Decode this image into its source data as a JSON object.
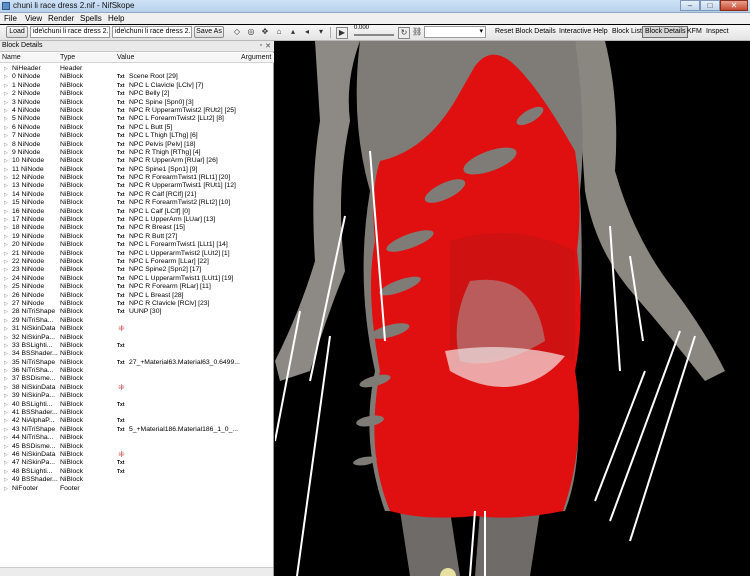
{
  "window": {
    "title": "chuni li race dress 2.nif - NifSkope",
    "minimize": "–",
    "maximize": "□",
    "close": "✕"
  },
  "menu": [
    "File",
    "View",
    "Render",
    "Spells",
    "Help"
  ],
  "toolbar": {
    "load": "Load",
    "load_path": "ide\\chuni li race dress 2.nif",
    "save_path": "ide\\chuni li race dress 2.nif",
    "save_as": "Save As",
    "lod_value": "0.000",
    "reset_block_details": "Reset Block Details",
    "interactive_help": "Interactive Help",
    "block_list": "Block List",
    "block_details": "Block Details",
    "kfm": "KFM",
    "inspect": "Inspect"
  },
  "panel": {
    "title": "Block Details",
    "float_icon": "▫",
    "close_icon": "✕",
    "columns": [
      "Name",
      "Type",
      "Value",
      "Argument"
    ],
    "rows": [
      {
        "name": "NiHeader",
        "type": "Header",
        "txt": false,
        "value": ""
      },
      {
        "name": "0 NiNode",
        "type": "NiBlock",
        "txt": true,
        "value": "Scene Root [29]"
      },
      {
        "name": "1 NiNode",
        "type": "NiBlock",
        "txt": true,
        "value": "NPC L Clavicle [LClv] [7]"
      },
      {
        "name": "2 NiNode",
        "type": "NiBlock",
        "txt": true,
        "value": "NPC Belly [2]"
      },
      {
        "name": "3 NiNode",
        "type": "NiBlock",
        "txt": true,
        "value": "NPC Spine [Spn0] [3]"
      },
      {
        "name": "4 NiNode",
        "type": "NiBlock",
        "txt": true,
        "value": "NPC R UpperarmTwist2 [RUt2] [25]"
      },
      {
        "name": "5 NiNode",
        "type": "NiBlock",
        "txt": true,
        "value": "NPC L ForearmTwist2 [LLt2] [8]"
      },
      {
        "name": "6 NiNode",
        "type": "NiBlock",
        "txt": true,
        "value": "NPC L Butt [5]"
      },
      {
        "name": "7 NiNode",
        "type": "NiBlock",
        "txt": true,
        "value": "NPC L Thigh [LThg] [6]"
      },
      {
        "name": "8 NiNode",
        "type": "NiBlock",
        "txt": true,
        "value": "NPC Pelvis [Pelv] [18]"
      },
      {
        "name": "9 NiNode",
        "type": "NiBlock",
        "txt": true,
        "value": "NPC R Thigh [RThg] [4]"
      },
      {
        "name": "10 NiNode",
        "type": "NiBlock",
        "txt": true,
        "value": "NPC R UpperArm [RUar] [26]"
      },
      {
        "name": "11 NiNode",
        "type": "NiBlock",
        "txt": true,
        "value": "NPC Spine1 [Spn1] [9]"
      },
      {
        "name": "12 NiNode",
        "type": "NiBlock",
        "txt": true,
        "value": "NPC R ForearmTwist1 [RLt1] [20]"
      },
      {
        "name": "13 NiNode",
        "type": "NiBlock",
        "txt": true,
        "value": "NPC R UpperarmTwist1 [RUt1] [12]"
      },
      {
        "name": "14 NiNode",
        "type": "NiBlock",
        "txt": true,
        "value": "NPC R Calf [RClf] [21]"
      },
      {
        "name": "15 NiNode",
        "type": "NiBlock",
        "txt": true,
        "value": "NPC R ForearmTwist2 [RLt2] [10]"
      },
      {
        "name": "16 NiNode",
        "type": "NiBlock",
        "txt": true,
        "value": "NPC L Calf [LClf] [0]"
      },
      {
        "name": "17 NiNode",
        "type": "NiBlock",
        "txt": true,
        "value": "NPC L UpperArm [LUar] [13]"
      },
      {
        "name": "18 NiNode",
        "type": "NiBlock",
        "txt": true,
        "value": "NPC R Breast [15]"
      },
      {
        "name": "19 NiNode",
        "type": "NiBlock",
        "txt": true,
        "value": "NPC R Butt [27]"
      },
      {
        "name": "20 NiNode",
        "type": "NiBlock",
        "txt": true,
        "value": "NPC L ForearmTwist1 [LLt1] [14]"
      },
      {
        "name": "21 NiNode",
        "type": "NiBlock",
        "txt": true,
        "value": "NPC L UpperarmTwist2 [LUt2] [1]"
      },
      {
        "name": "22 NiNode",
        "type": "NiBlock",
        "txt": true,
        "value": "NPC L Forearm [LLar] [22]"
      },
      {
        "name": "23 NiNode",
        "type": "NiBlock",
        "txt": true,
        "value": "NPC Spine2 [Spn2] [17]"
      },
      {
        "name": "24 NiNode",
        "type": "NiBlock",
        "txt": true,
        "value": "NPC L UpperarmTwist1 [LUt1] [19]"
      },
      {
        "name": "25 NiNode",
        "type": "NiBlock",
        "txt": true,
        "value": "NPC R Forearm [RLar] [11]"
      },
      {
        "name": "26 NiNode",
        "type": "NiBlock",
        "txt": true,
        "value": "NPC L Breast [28]"
      },
      {
        "name": "27 NiNode",
        "type": "NiBlock",
        "txt": true,
        "value": "NPC R Clavicle [RClv] [23]"
      },
      {
        "name": "28 NiTriShape",
        "type": "NiBlock",
        "txt": true,
        "value": "UUNP [30]"
      },
      {
        "name": "29 NiTriSha...",
        "type": "NiBlock",
        "txt": false,
        "value": ""
      },
      {
        "name": "31 NiSkinData",
        "type": "NiBlock",
        "txt": false,
        "skin": true,
        "value": ""
      },
      {
        "name": "32 NiSkinPa...",
        "type": "NiBlock",
        "txt": false,
        "value": ""
      },
      {
        "name": "33 BSLighti...",
        "type": "NiBlock",
        "txt": true,
        "value": ""
      },
      {
        "name": "34 BSShader...",
        "type": "NiBlock",
        "txt": false,
        "value": ""
      },
      {
        "name": "35 NiTriShape",
        "type": "NiBlock",
        "txt": true,
        "value": "27_+Material63.Material63_0.6499..."
      },
      {
        "name": "36 NiTriSha...",
        "type": "NiBlock",
        "txt": false,
        "value": ""
      },
      {
        "name": "37 BSDisme...",
        "type": "NiBlock",
        "txt": false,
        "value": ""
      },
      {
        "name": "38 NiSkinData",
        "type": "NiBlock",
        "txt": false,
        "skin": true,
        "value": ""
      },
      {
        "name": "39 NiSkinPa...",
        "type": "NiBlock",
        "txt": false,
        "value": ""
      },
      {
        "name": "40 BSLighti...",
        "type": "NiBlock",
        "txt": true,
        "value": ""
      },
      {
        "name": "41 BSShader...",
        "type": "NiBlock",
        "txt": false,
        "value": ""
      },
      {
        "name": "42 NiAlphaP...",
        "type": "NiBlock",
        "txt": true,
        "value": ""
      },
      {
        "name": "43 NiTriShape",
        "type": "NiBlock",
        "txt": true,
        "value": "5_+Material186.Material186_1_0_..."
      },
      {
        "name": "44 NiTriSha...",
        "type": "NiBlock",
        "txt": false,
        "value": ""
      },
      {
        "name": "45 BSDisme...",
        "type": "NiBlock",
        "txt": false,
        "value": ""
      },
      {
        "name": "46 NiSkinData",
        "type": "NiBlock",
        "txt": false,
        "skin": true,
        "value": ""
      },
      {
        "name": "47 NiSkinPa...",
        "type": "NiBlock",
        "txt": true,
        "value": ""
      },
      {
        "name": "48 BSLighti...",
        "type": "NiBlock",
        "txt": true,
        "value": ""
      },
      {
        "name": "49 BSShader...",
        "type": "NiBlock",
        "txt": false,
        "value": ""
      },
      {
        "name": "NiFooter",
        "type": "Footer",
        "txt": false,
        "value": ""
      }
    ],
    "txt_badge": "Txt",
    "skin_glyph": "⁜"
  },
  "colors": {
    "dress": "#e01010",
    "skin": "#8a8680",
    "bone_lines": "#ffffff"
  }
}
